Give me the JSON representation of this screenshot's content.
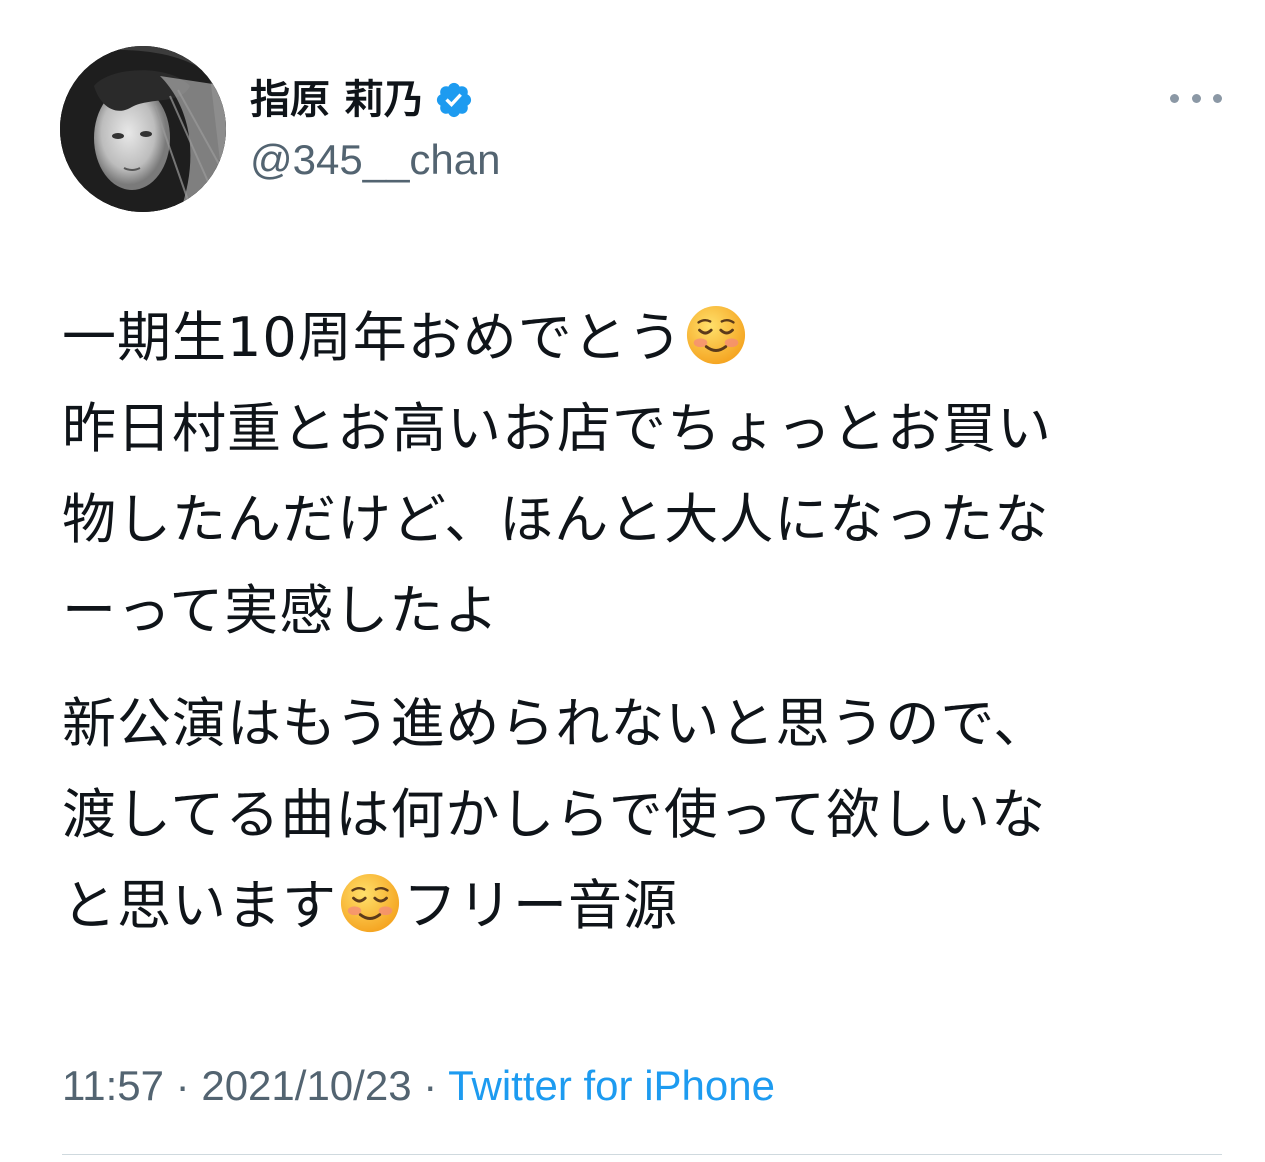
{
  "tweet": {
    "author": {
      "display_name": "指原 莉乃",
      "handle": "@345__chan",
      "verified": true
    },
    "text": {
      "paragraphs": [
        [
          [
            "一期生10周年おめでとう",
            "smiling-face-emoji"
          ],
          [
            "昨日村重とお高いお店でちょっとお買い"
          ],
          [
            "物したんだけど、ほんと大人になったな"
          ],
          [
            "ーって実感したよ"
          ]
        ],
        [
          [
            "新公演はもう進められないと思うので、"
          ],
          [
            "渡してる曲は何かしらで使って欲しいな"
          ],
          [
            "と思います",
            "smiling-face-emoji",
            "フリー音源"
          ]
        ]
      ]
    },
    "meta": {
      "time": "11:57",
      "separator": "·",
      "date": "2021/10/23",
      "source": "Twitter for iPhone"
    },
    "colors": {
      "text": "#0f1419",
      "secondary": "#536471",
      "link": "#1d9bf0",
      "verified": "#1d9bf0"
    },
    "icons": {
      "verified": "verified-badge-icon",
      "more": "more-options-icon",
      "emoji": "smiling-face-emoji"
    }
  }
}
